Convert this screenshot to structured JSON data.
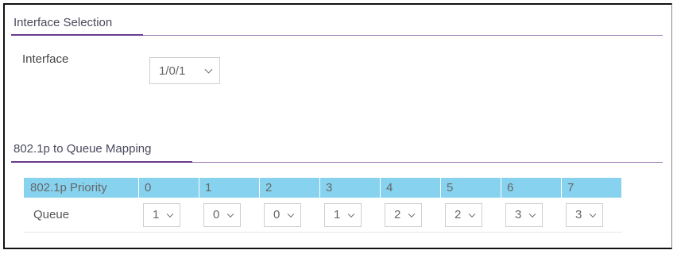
{
  "interface_selection": {
    "title": "Interface Selection",
    "interface_label": "Interface",
    "interface_value": "1/0/1"
  },
  "queue_mapping": {
    "title": "802.1p to Queue Mapping",
    "priority_header": "802.1p Priority",
    "queue_label": "Queue",
    "priorities": [
      "0",
      "1",
      "2",
      "3",
      "4",
      "5",
      "6",
      "7"
    ],
    "queues": [
      "1",
      "0",
      "0",
      "1",
      "2",
      "2",
      "3",
      "3"
    ]
  },
  "colors": {
    "section_rule": "#6a3b8f",
    "table_header": "#87d3ef"
  }
}
